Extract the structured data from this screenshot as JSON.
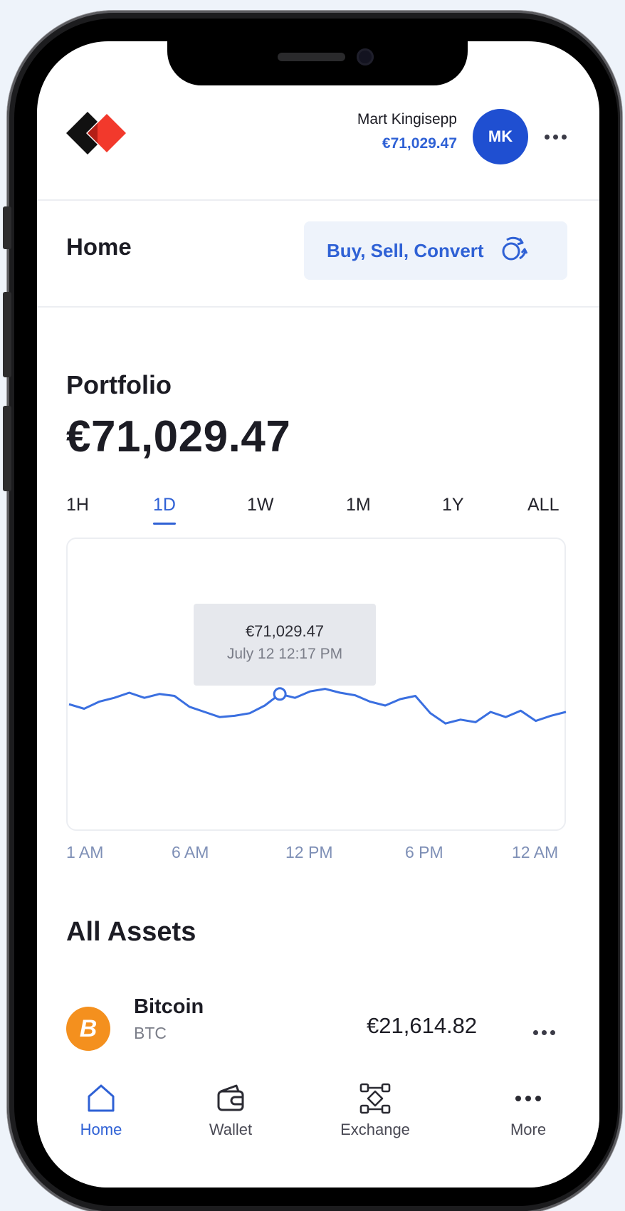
{
  "header": {
    "user_name": "Mart Kingisepp",
    "user_balance": "€71,029.47",
    "avatar_initials": "MK"
  },
  "page": {
    "title": "Home",
    "action_button": "Buy, Sell, Convert"
  },
  "portfolio": {
    "label": "Portfolio",
    "value": "€71,029.47"
  },
  "ranges": [
    {
      "label": "1H",
      "active": false
    },
    {
      "label": "1D",
      "active": true
    },
    {
      "label": "1W",
      "active": false
    },
    {
      "label": "1M",
      "active": false
    },
    {
      "label": "1Y",
      "active": false
    },
    {
      "label": "ALL",
      "active": false
    }
  ],
  "tooltip": {
    "value": "€71,029.47",
    "date": "July 12 12:17 PM"
  },
  "chart_data": {
    "type": "line",
    "x_tick_labels": [
      "1 AM",
      "6 AM",
      "12 PM",
      "6 PM",
      "12 AM"
    ],
    "series": [
      {
        "values": [
          0.42,
          0.35,
          0.46,
          0.52,
          0.6,
          0.52,
          0.58,
          0.55,
          0.38,
          0.3,
          0.22,
          0.24,
          0.28,
          0.4,
          0.58,
          0.52,
          0.62,
          0.66,
          0.6,
          0.56,
          0.46,
          0.4,
          0.5,
          0.55,
          0.28,
          0.12,
          0.18,
          0.14,
          0.3,
          0.22,
          0.32,
          0.16,
          0.24,
          0.3
        ]
      }
    ],
    "highlight_index": 14,
    "color": "#3a6fe0"
  },
  "assets": {
    "title": "All Assets",
    "items": [
      {
        "name": "Bitcoin",
        "ticker": "BTC",
        "value": "€21,614.82",
        "icon_glyph": "B",
        "color": "#f4901e"
      }
    ]
  },
  "tabs": [
    {
      "label": "Home",
      "icon": "home-icon",
      "active": true
    },
    {
      "label": "Wallet",
      "icon": "wallet-icon",
      "active": false
    },
    {
      "label": "Exchange",
      "icon": "exchange-icon",
      "active": false
    },
    {
      "label": "More",
      "icon": "more-dots-icon",
      "active": false
    }
  ],
  "colors": {
    "accent": "#2f61d5",
    "avatar": "#1f4fd1",
    "bitcoin": "#f4901e"
  }
}
